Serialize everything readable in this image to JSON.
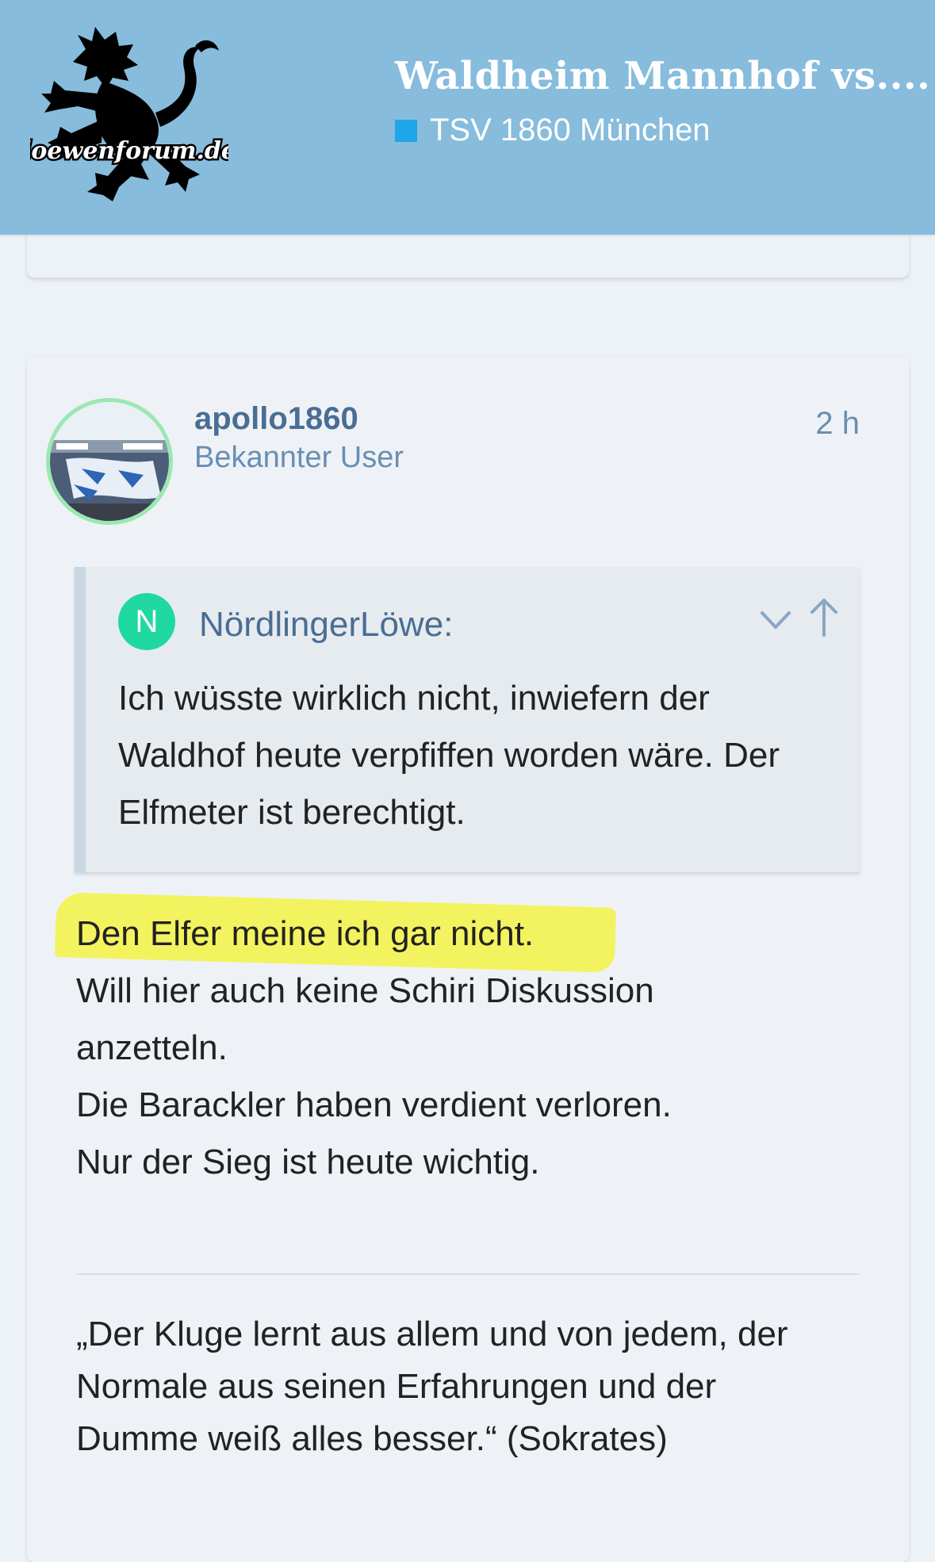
{
  "header": {
    "logo_text": "loewenforum.de",
    "topic_title": "Waldheim Mannhof vs....",
    "category": "TSV 1860 München",
    "category_color": "#1ea7e8",
    "background_color": "#87bcdc"
  },
  "post": {
    "username": "apollo1860",
    "user_title": "Bekannter User",
    "time": "2 h",
    "avatar": "stadium-crowd-avatar",
    "quote": {
      "badge_letter": "N",
      "author": "NördlingerLöwe:",
      "lines": [
        "Ich wüsste wirklich nicht, inwiefern der",
        "Waldhof heute verpfiffen worden wäre. Der",
        "Elfmeter ist berechtigt."
      ],
      "expand_icon": "chevron-down-icon",
      "jump_icon": "arrow-up-icon"
    },
    "body_lines": [
      "Den Elfer meine ich gar nicht.",
      "Will hier auch keine Schiri Diskussion",
      "anzetteln.",
      "Die Barackler haben verdient verloren.",
      "Nur der Sieg ist heute wichtig."
    ],
    "highlight_color": "#f2f256",
    "signature_lines": [
      "„Der Kluge lernt aus allem und von jedem, der",
      "Normale aus seinen Erfahrungen und der",
      "Dumme weiß alles besser.“ (Sokrates)"
    ]
  }
}
